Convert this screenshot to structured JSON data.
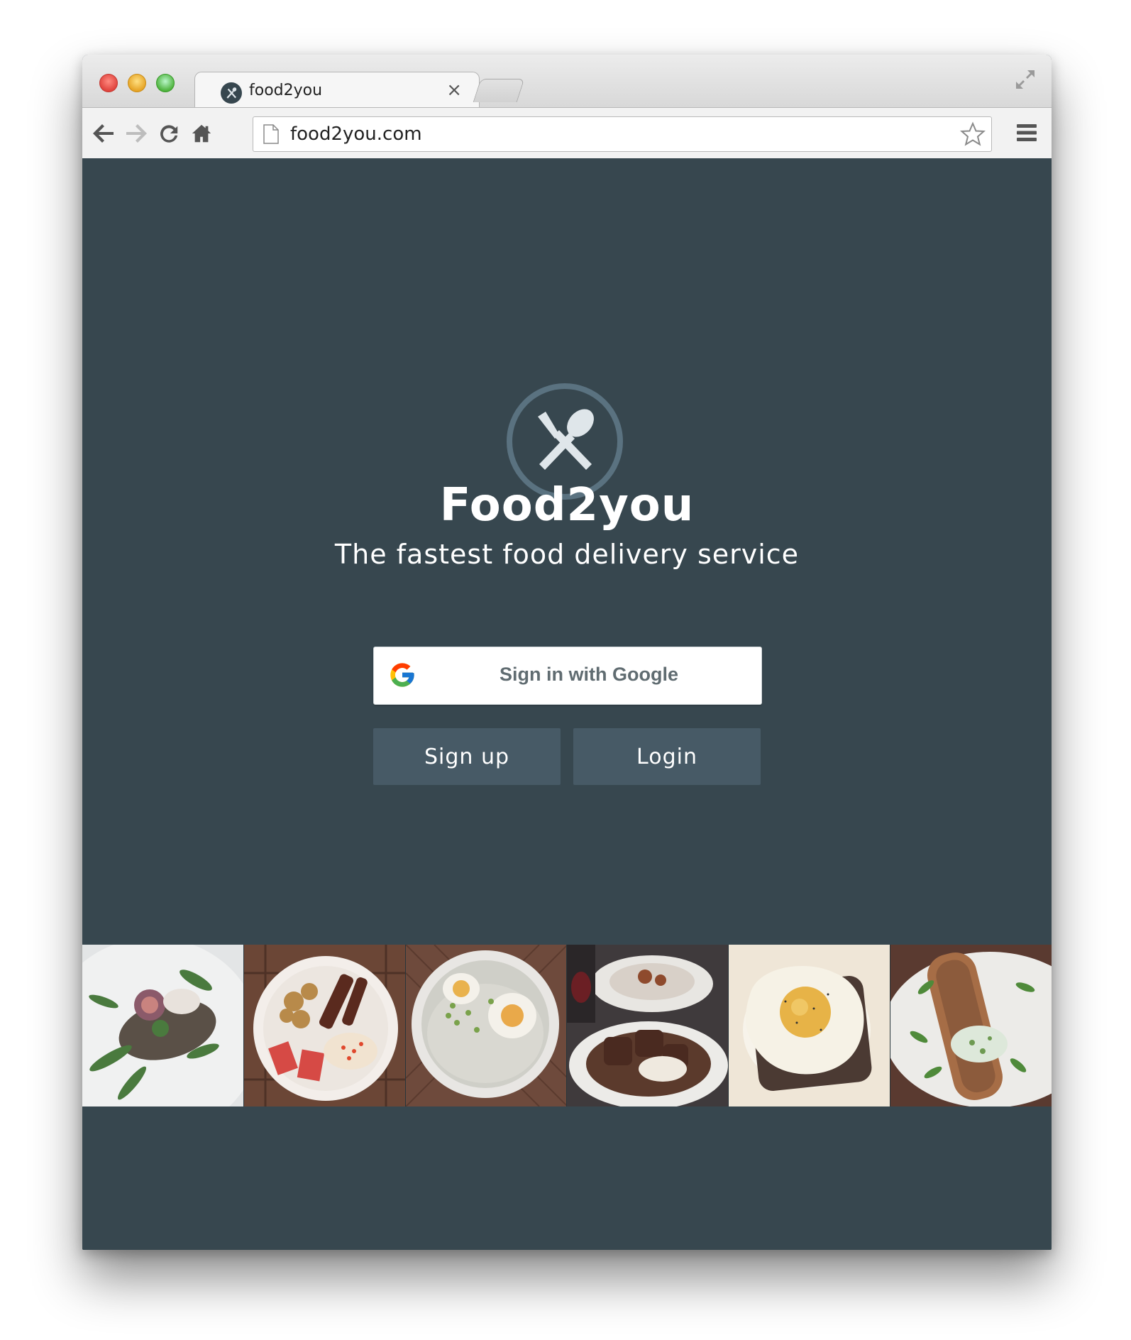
{
  "browser": {
    "tab_title": "food2you",
    "tab_close": "×",
    "url": "food2you.com"
  },
  "page": {
    "title": "Food2you",
    "subtitle": "The fastest food delivery service",
    "google_button": "Sign in with Google",
    "signup_button": "Sign up",
    "login_button": "Login",
    "gallery": [
      {
        "name": "fig-toast-photo"
      },
      {
        "name": "breakfast-plate-photo"
      },
      {
        "name": "egg-congee-photo"
      },
      {
        "name": "steak-mash-photo"
      },
      {
        "name": "fried-egg-toast-photo"
      },
      {
        "name": "bruschetta-photo"
      }
    ]
  },
  "colors": {
    "background": "#37474f",
    "button": "#475a66",
    "logo_ring": "#5a7280",
    "logo_glyph": "#dfe6ea"
  }
}
